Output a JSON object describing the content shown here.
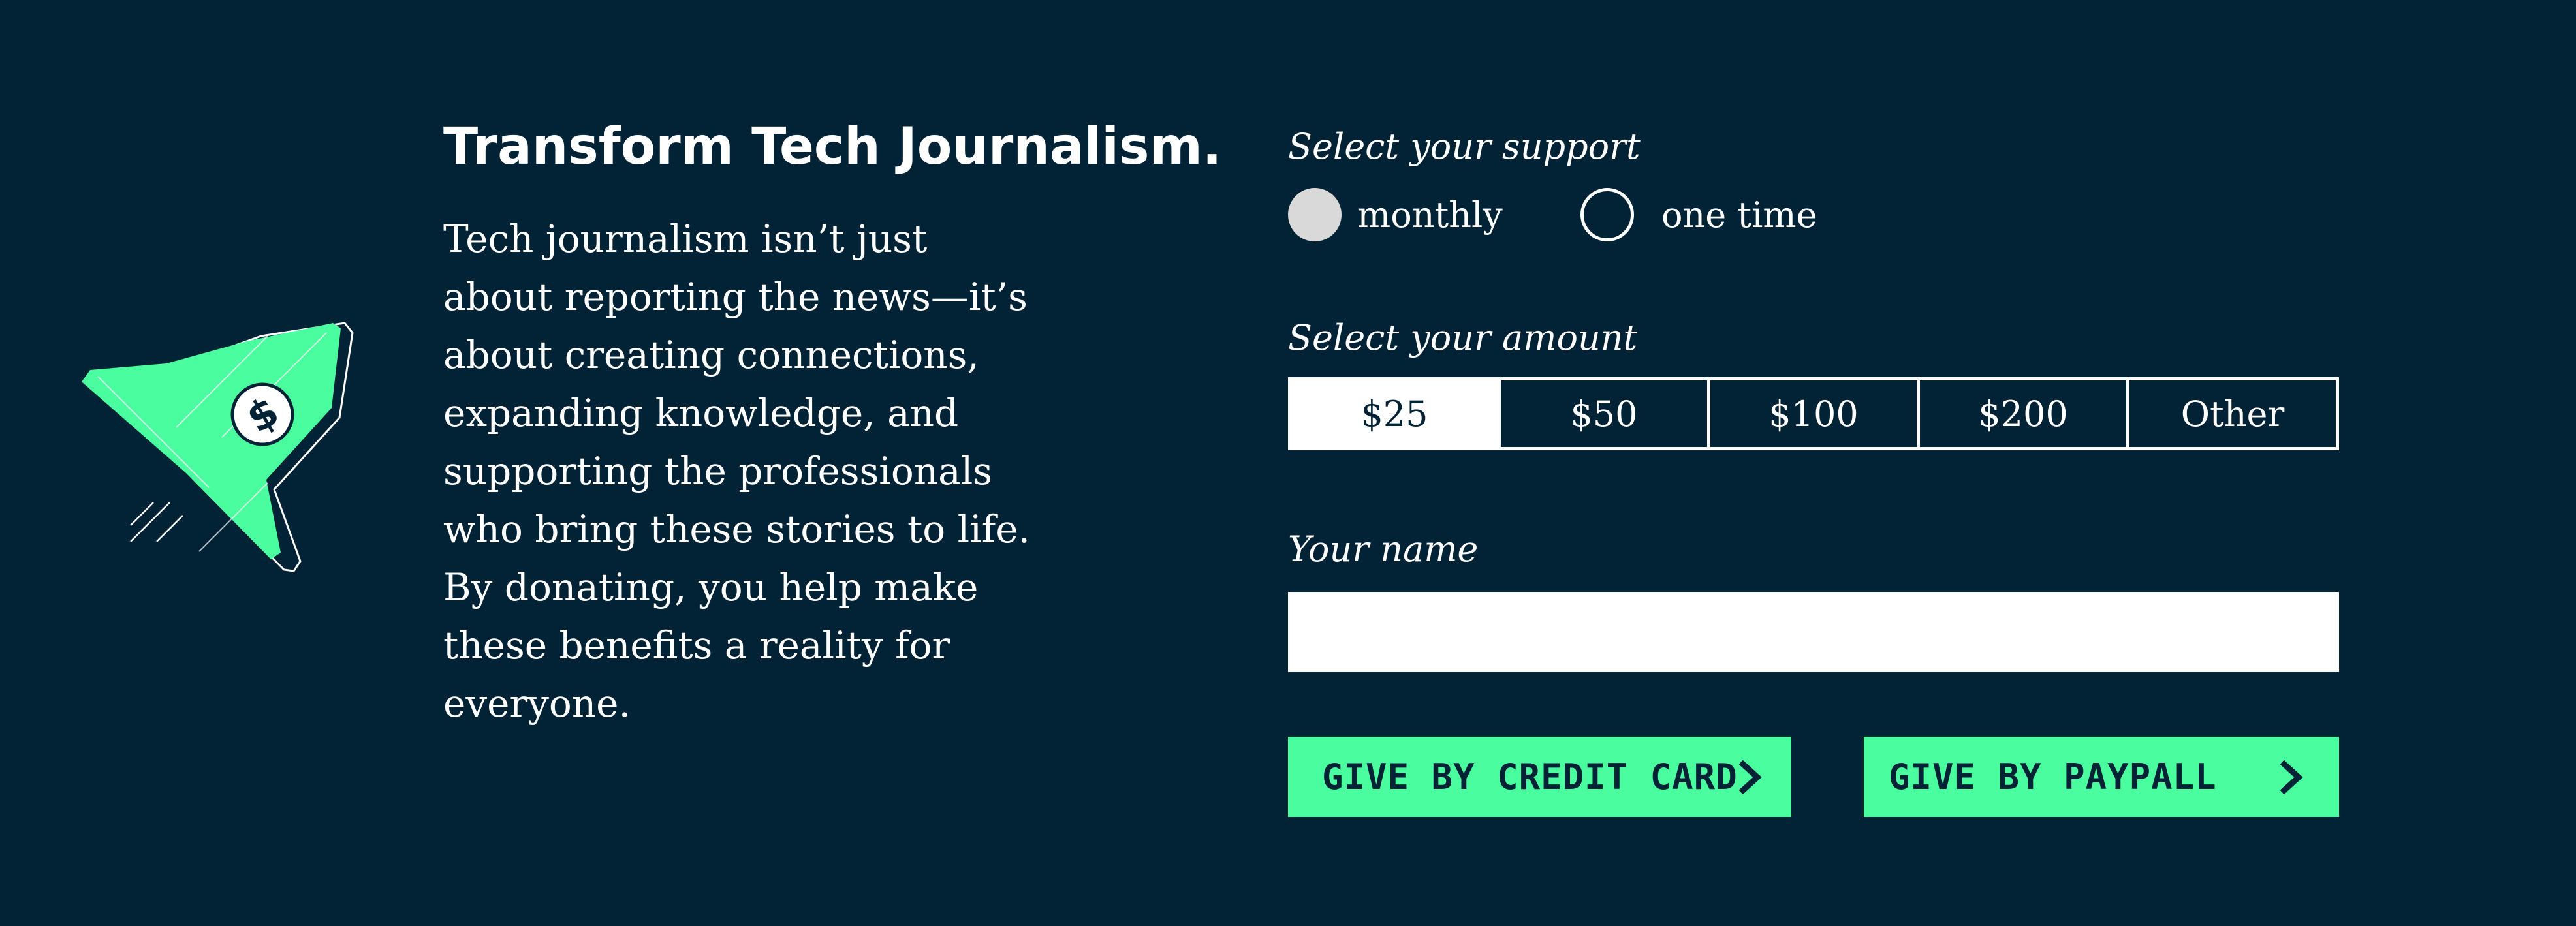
{
  "hero": {
    "title": "Transform Tech Journalism.",
    "body": "Tech journalism isn’t just about reporting the news—it’s about creating connections, expanding knowledge, and supporting the professionals who bring these stories to life. By donating, you help make these benefits a reality for everyone.",
    "illustration": "rocket-dollar-icon"
  },
  "support": {
    "label": "Select your support",
    "options": [
      {
        "label": "monthly",
        "selected": true
      },
      {
        "label": "one time",
        "selected": false
      }
    ]
  },
  "amount": {
    "label": "Select your amount",
    "options": [
      {
        "label": "$25",
        "selected": true
      },
      {
        "label": "$50",
        "selected": false
      },
      {
        "label": "$100",
        "selected": false
      },
      {
        "label": "$200",
        "selected": false
      },
      {
        "label": "Other",
        "selected": false
      }
    ]
  },
  "name_field": {
    "label": "Your name",
    "value": "",
    "placeholder": ""
  },
  "actions": {
    "credit_card": {
      "label": "GIVE BY CREDIT CARD",
      "icon": "chevron-right-icon"
    },
    "paypal": {
      "label": "GIVE BY PAYPALL",
      "icon": "chevron-right-icon"
    }
  },
  "colors": {
    "background": "#022235",
    "accent": "#4afe9f",
    "text": "#ffffff",
    "radio_selected": "#d9d9d9"
  }
}
